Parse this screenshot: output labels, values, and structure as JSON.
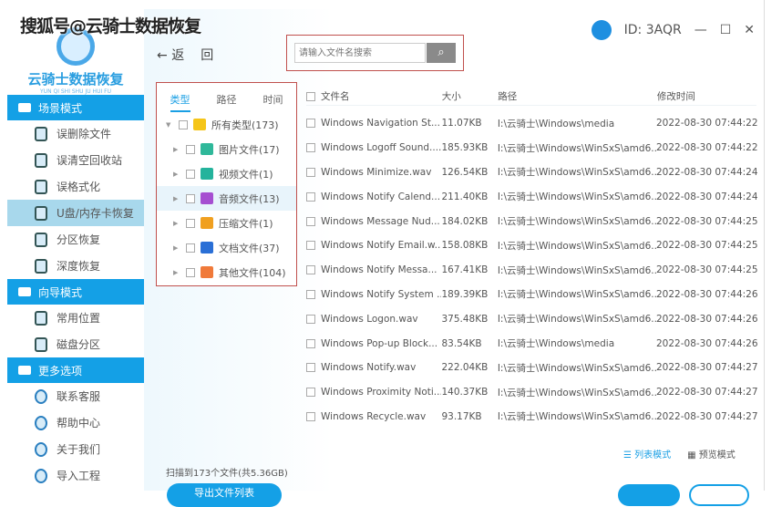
{
  "watermark": "搜狐号@云骑士数据恢复",
  "logo": {
    "title": "云骑士数据恢复",
    "subtitle": "YUN QI SHI SHU JU HUI FU"
  },
  "sidebar": {
    "sections": [
      {
        "label": "场景模式",
        "items": [
          {
            "label": "误删除文件"
          },
          {
            "label": "误清空回收站"
          },
          {
            "label": "误格式化"
          },
          {
            "label": "U盘/内存卡恢复",
            "active": true
          },
          {
            "label": "分区恢复"
          },
          {
            "label": "深度恢复"
          }
        ]
      },
      {
        "label": "向导模式",
        "items": [
          {
            "label": "常用位置"
          },
          {
            "label": "磁盘分区"
          }
        ]
      },
      {
        "label": "更多选项",
        "items": [
          {
            "label": "联系客服"
          },
          {
            "label": "帮助中心"
          },
          {
            "label": "关于我们"
          },
          {
            "label": "导入工程"
          }
        ]
      }
    ]
  },
  "header": {
    "back_label": "返",
    "back2_label": "回",
    "search_placeholder": "请输入文件名搜索",
    "id_label": "ID: 3AQR"
  },
  "tree": {
    "tabs": [
      "类型",
      "路径",
      "时间"
    ],
    "nodes": [
      {
        "label": "所有类型(173)",
        "color": "#f5c518"
      },
      {
        "label": "图片文件(17)",
        "color": "#2fb89a"
      },
      {
        "label": "视频文件(1)",
        "color": "#24b39c"
      },
      {
        "label": "音频文件(13)",
        "color": "#a64fd1"
      },
      {
        "label": "压缩文件(1)",
        "color": "#f0a020"
      },
      {
        "label": "文档文件(37)",
        "color": "#2a6fd6"
      },
      {
        "label": "其他文件(104)",
        "color": "#f07a3a"
      }
    ]
  },
  "table": {
    "headers": [
      "文件名",
      "大小",
      "路径",
      "修改时间"
    ],
    "rows": [
      [
        "Windows Navigation St...",
        "11.07KB",
        "I:\\云骑士\\Windows\\media",
        "2022-08-30 07:44:22"
      ],
      [
        "Windows Logoff Sound....",
        "185.93KB",
        "I:\\云骑士\\Windows\\WinSxS\\amd6...",
        "2022-08-30 07:44:22"
      ],
      [
        "Windows Minimize.wav",
        "126.54KB",
        "I:\\云骑士\\Windows\\WinSxS\\amd6...",
        "2022-08-30 07:44:24"
      ],
      [
        "Windows Notify Calend...",
        "211.40KB",
        "I:\\云骑士\\Windows\\WinSxS\\amd6...",
        "2022-08-30 07:44:24"
      ],
      [
        "Windows Message Nud...",
        "184.02KB",
        "I:\\云骑士\\Windows\\WinSxS\\amd6...",
        "2022-08-30 07:44:25"
      ],
      [
        "Windows Notify Email.w...",
        "158.08KB",
        "I:\\云骑士\\Windows\\WinSxS\\amd6...",
        "2022-08-30 07:44:25"
      ],
      [
        "Windows Notify Messa...",
        "167.41KB",
        "I:\\云骑士\\Windows\\WinSxS\\amd6...",
        "2022-08-30 07:44:25"
      ],
      [
        "Windows Notify System ...",
        "189.39KB",
        "I:\\云骑士\\Windows\\WinSxS\\amd6...",
        "2022-08-30 07:44:26"
      ],
      [
        "Windows Logon.wav",
        "375.48KB",
        "I:\\云骑士\\Windows\\WinSxS\\amd6...",
        "2022-08-30 07:44:26"
      ],
      [
        "Windows Pop-up Block...",
        "83.54KB",
        "I:\\云骑士\\Windows\\media",
        "2022-08-30 07:44:26"
      ],
      [
        "Windows Notify.wav",
        "222.04KB",
        "I:\\云骑士\\Windows\\WinSxS\\amd6...",
        "2022-08-30 07:44:27"
      ],
      [
        "Windows Proximity Noti...",
        "140.37KB",
        "I:\\云骑士\\Windows\\WinSxS\\amd6...",
        "2022-08-30 07:44:27"
      ],
      [
        "Windows Recycle.wav",
        "93.17KB",
        "I:\\云骑士\\Windows\\WinSxS\\amd6...",
        "2022-08-30 07:44:27"
      ]
    ]
  },
  "footer": {
    "scanned": "扫描到173个文件(共5.36GB)",
    "export_label": "导出文件列表",
    "list_mode": "列表模式",
    "preview_mode": "预览模式"
  },
  "colors": {
    "accent": "#14a0e6",
    "highlight": "#c0504d"
  }
}
